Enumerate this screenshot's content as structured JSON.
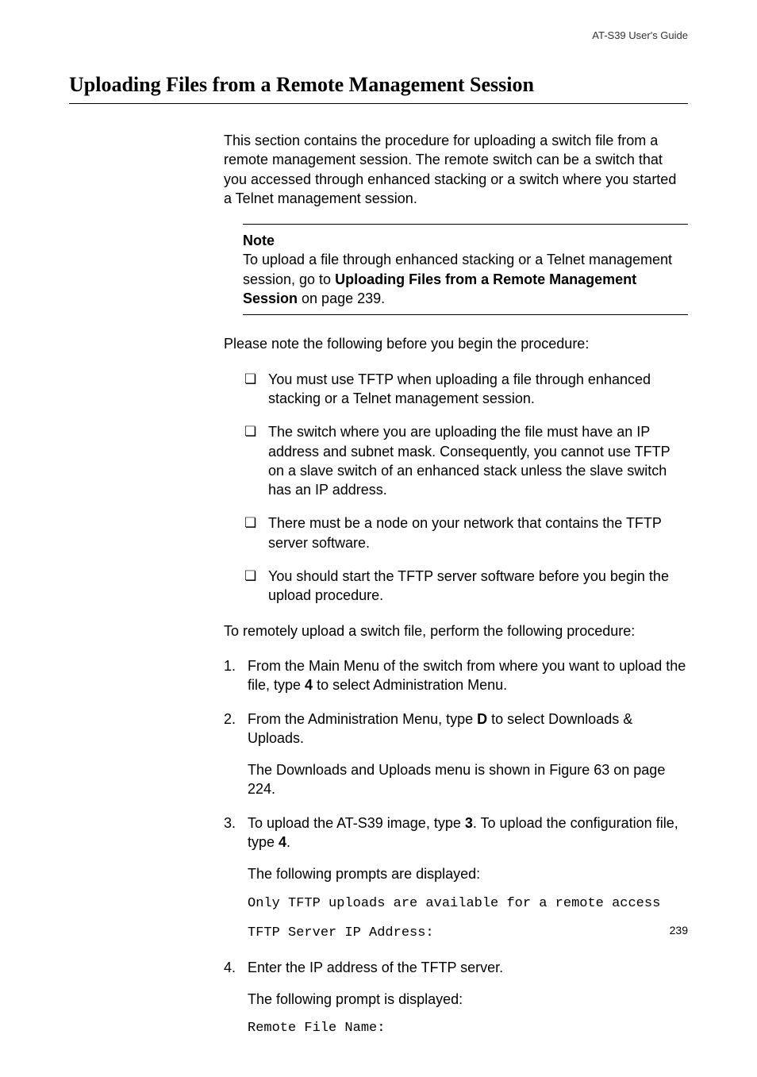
{
  "header": {
    "guide_title": "AT-S39 User's Guide"
  },
  "heading": "Uploading Files from a Remote Management Session",
  "intro": "This section contains the procedure for uploading a switch file from a remote management session. The remote switch can be a switch that you accessed through enhanced stacking or a switch where you started a Telnet management session.",
  "note": {
    "label": "Note",
    "text_before": "To upload a file through enhanced stacking or a Telnet management session, go to ",
    "link_bold": "Uploading Files from a Remote Management Session",
    "text_after": " on page 239."
  },
  "pre_list_para": "Please note the following before you begin the procedure:",
  "checklist": [
    "You must use TFTP when uploading a file through enhanced stacking or a Telnet management session.",
    "The switch where you are uploading the file must have an IP address and subnet mask. Consequently, you cannot use TFTP on a slave switch of an enhanced stack unless the slave switch has an IP address.",
    "There must be a node on your network that contains the TFTP server software.",
    "You should start the TFTP server software before you begin the upload procedure."
  ],
  "procedure_intro": "To remotely upload a switch file, perform the following procedure:",
  "steps": {
    "s1": {
      "pre": "From the Main Menu of the switch from where you want to upload the file, type ",
      "bold": "4",
      "post": " to select Administration Menu."
    },
    "s2": {
      "pre": "From the Administration Menu, type ",
      "bold": "D",
      "post": " to select Downloads & Uploads.",
      "sub": "The Downloads and Uploads menu is shown in Figure 63 on page 224."
    },
    "s3": {
      "pre": "To upload the AT-S39 image, type ",
      "bold1": "3",
      "mid": ". To upload the configuration file, type ",
      "bold2": "4",
      "post": ".",
      "sub": "The following prompts are displayed:",
      "code1": "Only TFTP uploads are available for a remote access",
      "code2": "TFTP Server IP Address:"
    },
    "s4": {
      "text": "Enter the IP address of the TFTP server.",
      "sub": "The following prompt is displayed:",
      "code": "Remote File Name:"
    }
  },
  "page_number": "239"
}
